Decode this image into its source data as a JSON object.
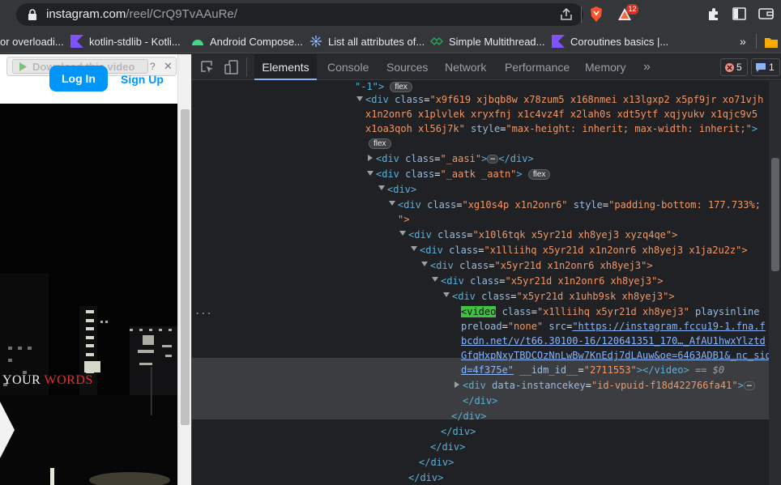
{
  "browser": {
    "url_host": "instagram.com",
    "url_path": "/reel/CrQ9TvAAuRe/",
    "brave_badge_count": "12"
  },
  "bookmarks": [
    {
      "label": "or overloadi...",
      "icon": "page-icon"
    },
    {
      "label": "kotlin-stdlib - Kotli...",
      "icon": "kotlin-icon"
    },
    {
      "label": "Android Compose...",
      "icon": "android-icon"
    },
    {
      "label": "List all attributes of...",
      "icon": "stackoverflow-icon"
    },
    {
      "label": "Simple Multithread...",
      "icon": "link-icon"
    },
    {
      "label": "Coroutines basics |...",
      "icon": "kotlin-icon"
    }
  ],
  "page": {
    "download_label": "Download this video",
    "login_label": "Log In",
    "signup_label": "Sign Up",
    "overlay_text_white": "YOUR ",
    "overlay_text_red": "WORDS"
  },
  "devtools": {
    "tabs": [
      "Elements",
      "Console",
      "Sources",
      "Network",
      "Performance",
      "Memory"
    ],
    "more_tabs": "»",
    "error_count": "5",
    "message_count": "1",
    "flex_badge": "flex",
    "dom": {
      "l0": "\"-1\">",
      "l1_tag": "<div ",
      "l1_an": "class",
      "l1_av": "\"x9f619 xjbqb8w x78zum5 x168nmei x13lgxp2 x5pf9jr xo71vjh",
      "l2": "x1n2onr6 x1plvlek xryxfnj x1c4vz4f x2lah0s xdt5ytf xqjyukv x1qjc9v5",
      "l3_a": "x1oa3qoh xl56j7k\"",
      "l3_an": " style",
      "l3_av": "\"max-height: inherit; max-width: inherit;\"",
      "l3_end": ">",
      "l5_a": "<div ",
      "l5_an": "class",
      "l5_av": "\"_aasi\"",
      "l5_end": "</div>",
      "l6_a": "<div ",
      "l6_an": "class",
      "l6_av": "\"_aatk _aatn\"",
      "l7": "<div>",
      "l8_a": "<div ",
      "l8_an": "class",
      "l8_av": "\"xg10s4p x1n2onr6\"",
      "l8_an2": " style",
      "l8_av2": "\"padding-bottom: 177.733%;",
      "l9": "\">",
      "l10_a": "<div ",
      "l10_an": "class",
      "l10_av": "\"x10l6tqk x5yr21d xh8yej3 xyzq4qe\">",
      "l11_a": "<div ",
      "l11_an": "class",
      "l11_av": "\"x1lliihq x5yr21d x1n2onr6 xh8yej3 x1ja2u2z\">",
      "l12_a": "<div ",
      "l12_an": "class",
      "l12_av": "\"x5yr21d x1n2onr6 xh8yej3\">",
      "l13_a": "<div ",
      "l13_an": "class",
      "l13_av": "\"x5yr21d x1n2onr6 xh8yej3\">",
      "l14_a": "<div ",
      "l14_an": "class",
      "l14_av": "\"x5yr21d x1uhb9sk xh8yej3\">",
      "sel_dots": "...",
      "v1_tag": "<video",
      "v1_an": " class",
      "v1_av": "\"x1lliihq x5yr21d xh8yej3\"",
      "v1_an2": " playsinline",
      "v2_an": "preload",
      "v2_av": "\"none\"",
      "v2_an2": " src",
      "v2_link": "\"https://instagram.fccu19-1.fna.f",
      "v3_link": "bcdn.net/v/t66.30100-16/120641351_170…_AfAU1hwxYlztd",
      "v4_link": "GfqHxpNxyTBDCOzNnLwBw7KnEdj7dLAuw&oe=6463ADB1&_nc_sid",
      "v5_link": "d=4f375e\"",
      "v5_an": " __idm_id__",
      "v5_av": "\"2711553\"",
      "v5_end": "></video>",
      "v5_eq": " == $0",
      "l16_a": "<div ",
      "l16_an": "data-instancekey",
      "l16_av": "\"id-vpuid-f18d422766fa41\"",
      "l16_end": ">",
      "close": "</div>"
    }
  }
}
